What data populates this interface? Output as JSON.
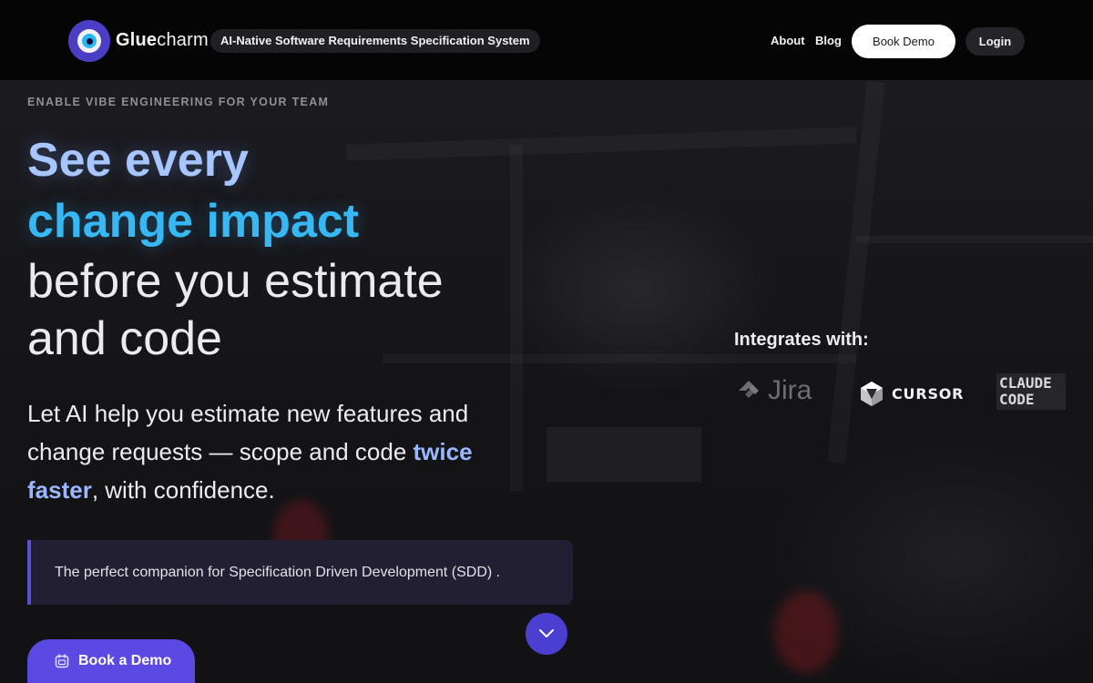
{
  "header": {
    "brand_bold": "Glue",
    "brand_light": "charm",
    "tagline": "AI-Native Software Requirements Specification System",
    "nav": {
      "about": "About",
      "blog": "Blog",
      "book_demo": "Book Demo",
      "login": "Login"
    }
  },
  "hero": {
    "eyebrow": "ENABLE VIBE ENGINEERING FOR YOUR TEAM",
    "headline_1": "See every",
    "headline_2": "change impact",
    "headline_3": "before you estimate",
    "headline_4": "and code",
    "sub_part1": "Let AI help you estimate new features and change requests — scope and code ",
    "sub_accent": "twice faster",
    "sub_part2": ", with confidence.",
    "callout": "The perfect companion for Specification Driven Development (SDD) .",
    "cta": "Book a Demo"
  },
  "integrations": {
    "title": "Integrates with:",
    "items": [
      {
        "name": "Jira",
        "icon": "jira-icon"
      },
      {
        "name": "CURSOR",
        "icon": "cursor-icon"
      },
      {
        "name": "CLAUDE CODE",
        "line1": "CLAUDE",
        "line2": "CODE"
      }
    ]
  },
  "colors": {
    "accent": "#5a4ae3",
    "headline_blue_light": "#a7c5ff",
    "headline_blue": "#35b8f3",
    "header_bg": "#050506"
  }
}
